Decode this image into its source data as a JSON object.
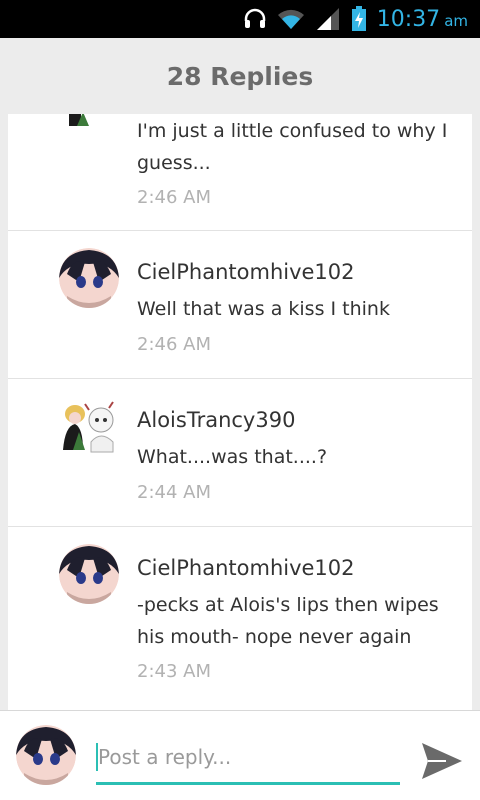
{
  "status_bar": {
    "time": "10:37",
    "ampm": "am",
    "icons": [
      "headphones-icon",
      "wifi-icon",
      "signal-icon",
      "battery-charging-icon"
    ]
  },
  "header": {
    "title": "28 Replies"
  },
  "replies": [
    {
      "username": "",
      "message": "I'm just a little confused to why I guess...",
      "time": "2:46 AM",
      "avatar": "alois-avatar"
    },
    {
      "username": "CielPhantomhive102",
      "message": "Well that was a kiss I think",
      "time": "2:46 AM",
      "avatar": "ciel-avatar"
    },
    {
      "username": "AloisTrancy390",
      "message": "What....was that....?",
      "time": "2:44 AM",
      "avatar": "alois-avatar"
    },
    {
      "username": "CielPhantomhive102",
      "message": "-pecks at Alois's lips then wipes his mouth-  nope never again",
      "time": "2:43 AM",
      "avatar": "ciel-avatar"
    }
  ],
  "compose": {
    "placeholder": "Post a reply...",
    "value": "",
    "send_icon": "send-icon",
    "accent": "#2bbfb4"
  },
  "colors": {
    "status_accent": "#33b5e5",
    "header_bg": "#ececec",
    "muted_text": "#b2b2b2"
  }
}
